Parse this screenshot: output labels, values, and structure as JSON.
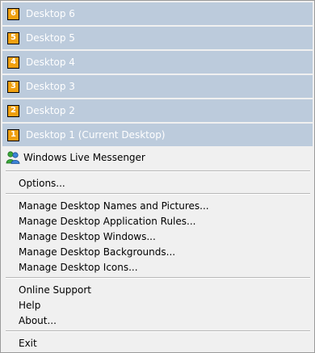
{
  "desktops": [
    {
      "number": "6",
      "label": "Desktop 6"
    },
    {
      "number": "5",
      "label": "Desktop 5"
    },
    {
      "number": "4",
      "label": "Desktop 4"
    },
    {
      "number": "3",
      "label": "Desktop 3"
    },
    {
      "number": "2",
      "label": "Desktop 2"
    },
    {
      "number": "1",
      "label": "Desktop 1 (Current Desktop)"
    }
  ],
  "menu": {
    "windows_live_messenger": "Windows Live Messenger",
    "options": "Options...",
    "manage_names": "Manage Desktop Names and Pictures...",
    "manage_app_rules": "Manage Desktop Application Rules...",
    "manage_windows": "Manage Desktop Windows...",
    "manage_backgrounds": "Manage Desktop Backgrounds...",
    "manage_icons": "Manage Desktop Icons...",
    "online_support": "Online Support",
    "help": "Help",
    "about": "About...",
    "exit": "Exit"
  },
  "icons": {
    "desktop_badge": "number-badge-icon",
    "messenger": "messenger-buddies-icon"
  },
  "colors": {
    "desktop_row_bg": "#bccbdc",
    "badge_bg": "#f0a010",
    "menu_bg": "#f0f0f0"
  }
}
